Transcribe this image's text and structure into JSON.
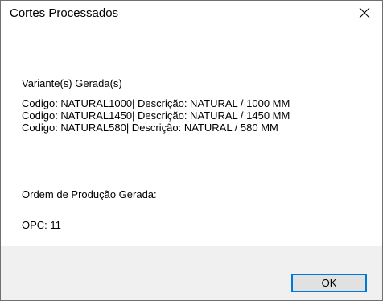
{
  "window": {
    "title": "Cortes Processados",
    "close_icon": "close-icon"
  },
  "message": {
    "variants_heading": "Variante(s) Gerada(s)",
    "variants": [
      "Codigo: NATURAL1000| Descrição: NATURAL / 1000 MM",
      "Codigo: NATURAL1450| Descrição: NATURAL / 1450 MM",
      "Codigo: NATURAL580| Descrição: NATURAL / 580 MM"
    ],
    "order_heading": "Ordem de Produção Gerada:",
    "order_value": "OPC: 11"
  },
  "buttons": {
    "ok_label": "OK"
  },
  "colors": {
    "footer_background": "#f0f0f0",
    "button_focus_border": "#0078d7",
    "button_face": "#e1e1e1"
  }
}
